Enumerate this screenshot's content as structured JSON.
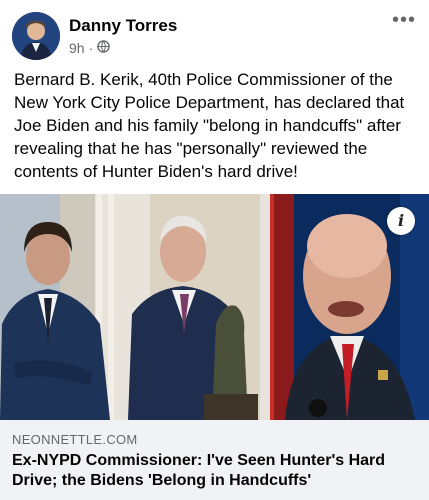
{
  "post": {
    "author": "Danny Torres",
    "time": "9h",
    "separator": "·",
    "privacy_icon": "globe-icon",
    "more_icon": "more-horizontal-icon",
    "text": "Bernard B. Kerik, 40th Police Commissioner of the New York City Police Department, has declared that Joe Biden and his family \"belong in handcuffs\" after revealing that he has \"personally\" reviewed the contents of Hunter Biden's hard drive!"
  },
  "link": {
    "info_label": "i",
    "domain": "NEONNETTLE.COM",
    "headline": "Ex-NYPD Commissioner: I've Seen Hunter's Hard Drive; the Bidens 'Belong in Handcuffs'"
  }
}
